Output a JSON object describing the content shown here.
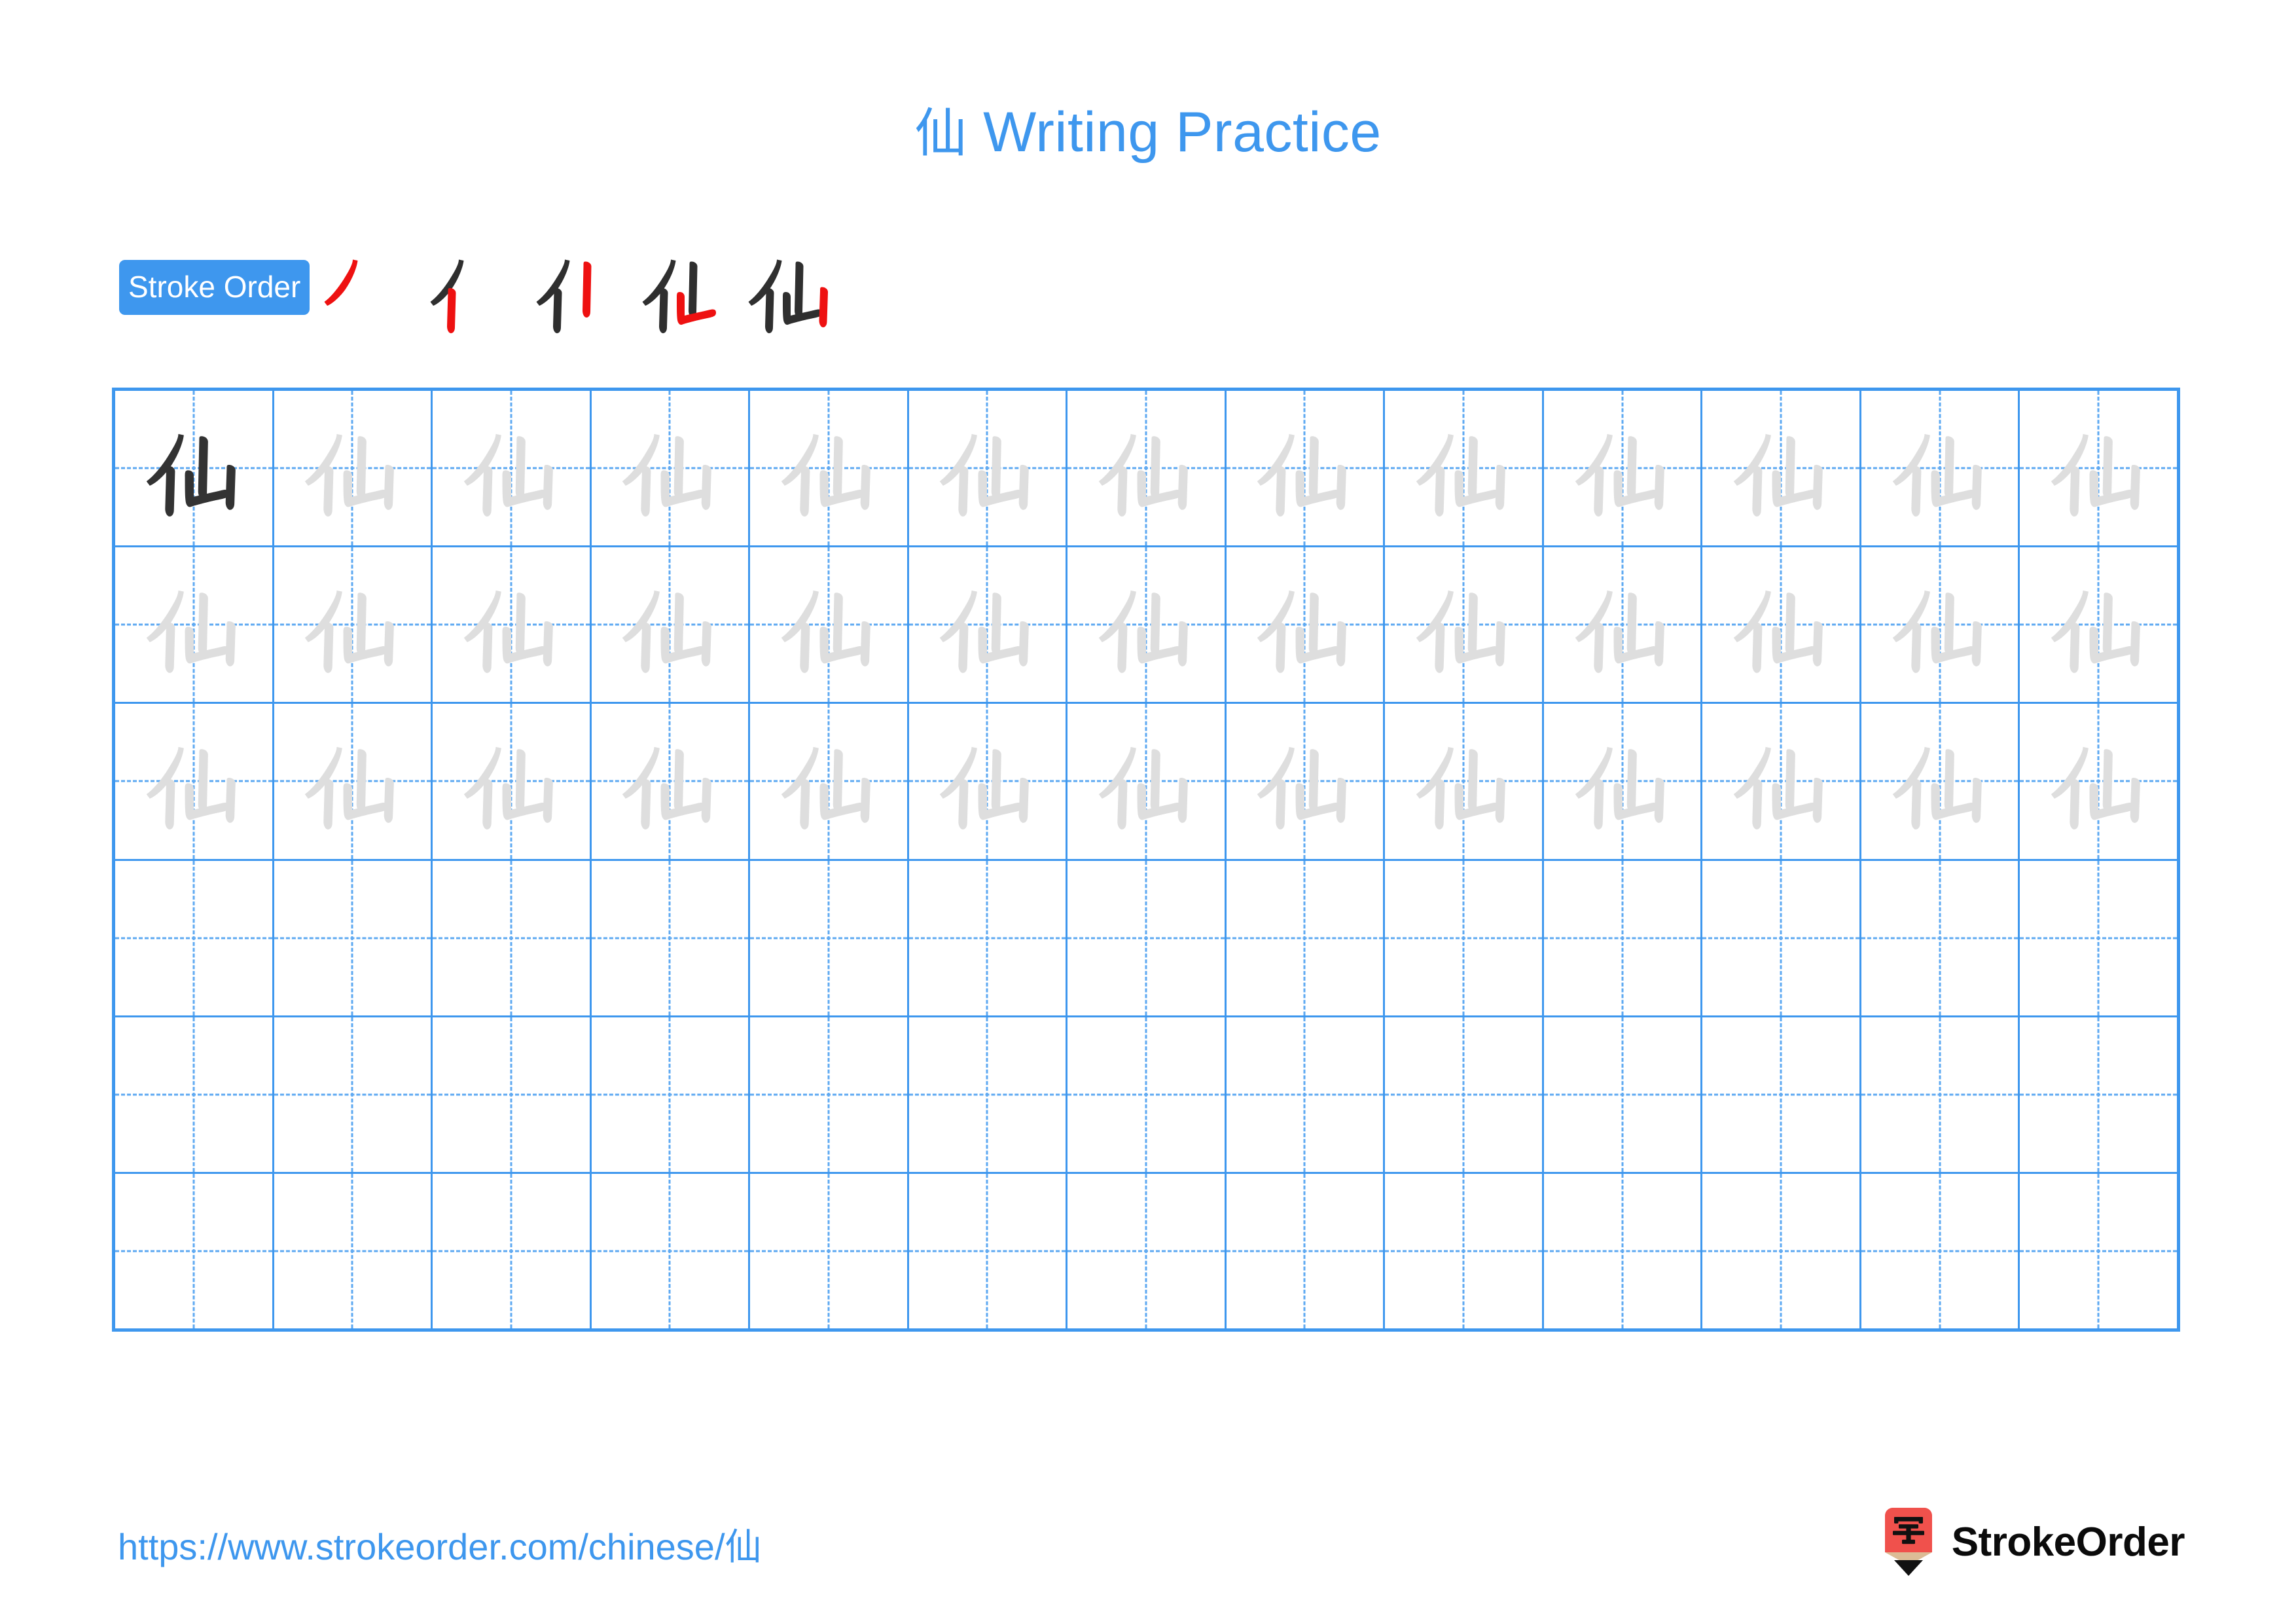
{
  "page": {
    "title_character": "仙",
    "title_text": "Writing Practice",
    "title_full": "仙 Writing Practice",
    "accent_color": "#3E97EE",
    "grid_line_color": "#3E97EE",
    "guide_line_color": "#5EA9F2",
    "dark_glyph_color": "#333333",
    "trace_glyph_color": "#DEDEDE",
    "new_stroke_color": "#EE1111",
    "done_stroke_color": "#2F2F2F",
    "background_color": "#FFFFFF"
  },
  "stroke_order": {
    "label": "Stroke Order",
    "character": "仙",
    "total_strokes": 5,
    "steps": [
      {
        "index": 1,
        "strokes_shown": 1,
        "new_stroke": 1,
        "name": "piě"
      },
      {
        "index": 2,
        "strokes_shown": 2,
        "new_stroke": 2,
        "name": "shù"
      },
      {
        "index": 3,
        "strokes_shown": 3,
        "new_stroke": 3,
        "name": "shù"
      },
      {
        "index": 4,
        "strokes_shown": 4,
        "new_stroke": 4,
        "name": "shù-zhé"
      },
      {
        "index": 5,
        "strokes_shown": 5,
        "new_stroke": 5,
        "name": "shù"
      }
    ]
  },
  "practice_grid": {
    "columns": 13,
    "rows": 6,
    "rows_data": [
      {
        "row": 1,
        "cells": [
          "dark",
          "trace",
          "trace",
          "trace",
          "trace",
          "trace",
          "trace",
          "trace",
          "trace",
          "trace",
          "trace",
          "trace",
          "trace"
        ]
      },
      {
        "row": 2,
        "cells": [
          "trace",
          "trace",
          "trace",
          "trace",
          "trace",
          "trace",
          "trace",
          "trace",
          "trace",
          "trace",
          "trace",
          "trace",
          "trace"
        ]
      },
      {
        "row": 3,
        "cells": [
          "trace",
          "trace",
          "trace",
          "trace",
          "trace",
          "trace",
          "trace",
          "trace",
          "trace",
          "trace",
          "trace",
          "trace",
          "trace"
        ]
      },
      {
        "row": 4,
        "cells": [
          "empty",
          "empty",
          "empty",
          "empty",
          "empty",
          "empty",
          "empty",
          "empty",
          "empty",
          "empty",
          "empty",
          "empty",
          "empty"
        ]
      },
      {
        "row": 5,
        "cells": [
          "empty",
          "empty",
          "empty",
          "empty",
          "empty",
          "empty",
          "empty",
          "empty",
          "empty",
          "empty",
          "empty",
          "empty",
          "empty"
        ]
      },
      {
        "row": 6,
        "cells": [
          "empty",
          "empty",
          "empty",
          "empty",
          "empty",
          "empty",
          "empty",
          "empty",
          "empty",
          "empty",
          "empty",
          "empty",
          "empty"
        ]
      }
    ]
  },
  "footer": {
    "url": "https://www.strokeorder.com/chinese/仙",
    "brand_name": "StrokeOrder",
    "brand_mark_character": "字",
    "brand_mark_colors": {
      "body": "#F0514C",
      "wood": "#DCBC96",
      "tip": "#111111",
      "char": "#111111"
    }
  }
}
